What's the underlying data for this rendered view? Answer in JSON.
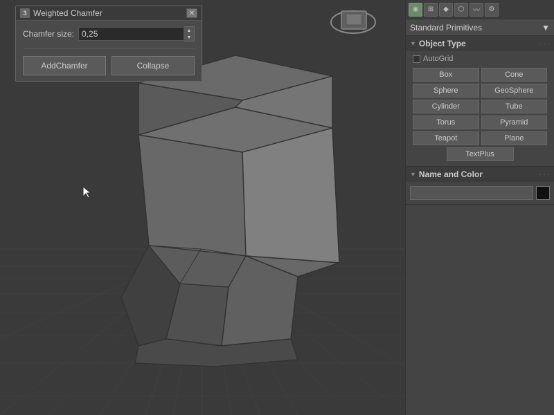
{
  "dialog": {
    "title": "Weighted Chamfer",
    "title_num": "3",
    "chamfer_label": "Chamfer size:",
    "chamfer_value": "0,25",
    "add_chamfer_label": "AddChamfer",
    "collapse_label": "Collapse"
  },
  "right_panel": {
    "dropdown_label": "Standard Primitives",
    "object_type_label": "Object Type",
    "autogrid_label": "AutoGrid",
    "buttons": [
      {
        "label": "Box",
        "col": 1
      },
      {
        "label": "Cone",
        "col": 2
      },
      {
        "label": "Sphere",
        "col": 1
      },
      {
        "label": "GeoSphere",
        "col": 2
      },
      {
        "label": "Cylinder",
        "col": 1
      },
      {
        "label": "Tube",
        "col": 2
      },
      {
        "label": "Torus",
        "col": 1
      },
      {
        "label": "Pyramid",
        "col": 2
      },
      {
        "label": "Teapot",
        "col": 1
      },
      {
        "label": "Plane",
        "col": 2
      },
      {
        "label": "TextPlus",
        "single": true
      }
    ],
    "name_color_label": "Name and Color",
    "name_placeholder": ""
  },
  "toolbar_icons": [
    "●",
    "⊞",
    "◆",
    "⬡",
    "〰",
    "⚙"
  ],
  "colors": {
    "bg_viewport": "#3a3a3a",
    "bg_panel": "#444444",
    "bg_dark": "#3c3c3c",
    "accent": "#5a5a5a",
    "color_swatch": "#111111"
  }
}
